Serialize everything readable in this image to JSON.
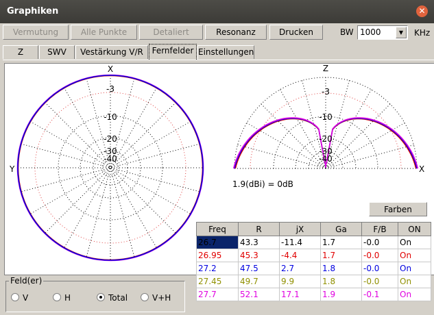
{
  "window": {
    "title": "Graphiken"
  },
  "toolbar": {
    "buttons": [
      {
        "label": "Vermutung",
        "enabled": false
      },
      {
        "label": "Alle Punkte",
        "enabled": false
      },
      {
        "label": "Detaliert",
        "enabled": false
      },
      {
        "label": "Resonanz",
        "enabled": true
      },
      {
        "label": "Drucken",
        "enabled": true
      }
    ],
    "bw_label": "BW",
    "bw_value": "1000",
    "unit": "KHz"
  },
  "tabs": [
    "Z",
    "SWV",
    "Vestärkung V/R",
    "Fernfelder",
    "Einstellungen"
  ],
  "active_tab": "Fernfelder",
  "plot": {
    "left_labels": {
      "top": "X",
      "side": "Y",
      "rings": [
        "-3",
        "-10",
        "-20",
        "-30",
        "-40"
      ]
    },
    "right_labels": {
      "top": "Z",
      "side": "X",
      "rings": [
        "-3",
        "-10",
        "-20",
        "-30",
        "-40"
      ]
    },
    "gain_caption": "1.9(dBi) = 0dB",
    "farben_label": "Farben"
  },
  "table": {
    "headers": [
      "Freq",
      "R",
      "jX",
      "Ga",
      "F/B",
      "ON"
    ],
    "rows": [
      {
        "freq": "26.7",
        "r": "43.3",
        "jx": "-11.4",
        "ga": "1.7",
        "fb": "-0.0",
        "on": "On",
        "color": "#000000"
      },
      {
        "freq": "26.95",
        "r": "45.3",
        "jx": "-4.4",
        "ga": "1.7",
        "fb": "-0.0",
        "on": "On",
        "color": "#e00000"
      },
      {
        "freq": "27.2",
        "r": "47.5",
        "jx": "2.7",
        "ga": "1.8",
        "fb": "-0.0",
        "on": "On",
        "color": "#0000e0"
      },
      {
        "freq": "27.45",
        "r": "49.7",
        "jx": "9.9",
        "ga": "1.8",
        "fb": "-0.0",
        "on": "On",
        "color": "#909000"
      },
      {
        "freq": "27.7",
        "r": "52.1",
        "jx": "17.1",
        "ga": "1.9",
        "fb": "-0.1",
        "on": "On",
        "color": "#e000e0"
      }
    ]
  },
  "feld": {
    "legend": "Feld(er)",
    "options": [
      "V",
      "H",
      "Total",
      "V+H"
    ],
    "selected": "Total"
  },
  "colors": {
    "trace_blue": "#0000e0",
    "trace_red": "#e00000",
    "trace_magenta": "#e000e0",
    "trace_olive": "#909000",
    "selection": "#0a246a"
  }
}
